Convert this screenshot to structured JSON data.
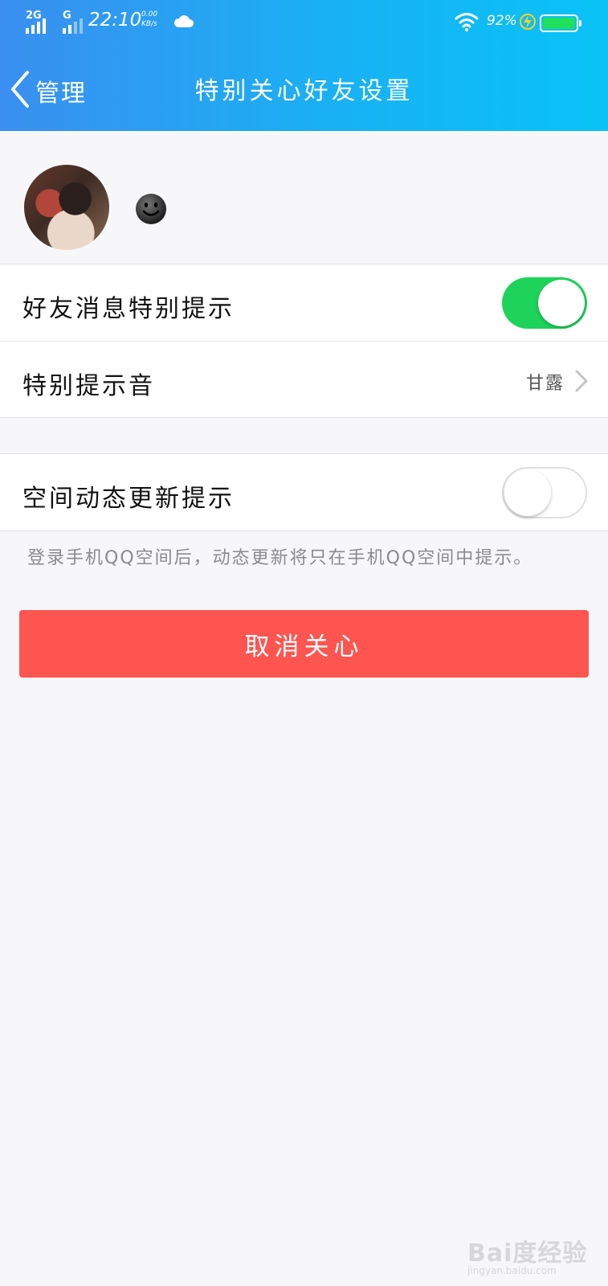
{
  "status_bar": {
    "network_1": "2G",
    "network_2": "G",
    "time": "22:10",
    "speed_value": "0.00",
    "speed_unit": "KB/s",
    "battery_percent": "92%",
    "icons": [
      "signal-icon",
      "cloud-icon",
      "wifi-icon",
      "charging-icon",
      "battery-icon"
    ]
  },
  "nav": {
    "back_label": "管理",
    "title": "特别关心好友设置"
  },
  "settings": {
    "group1": [
      {
        "label": "好友消息特别提示",
        "type": "switch",
        "on": true
      },
      {
        "label": "特别提示音",
        "type": "link",
        "value": "甘露"
      }
    ],
    "group2": [
      {
        "label": "空间动态更新提示",
        "type": "switch",
        "on": false
      }
    ],
    "note": "登录手机QQ空间后，动态更新将只在手机QQ空间中提示。"
  },
  "cancel_button": "取消关心",
  "watermark": {
    "main": "Bai度经验",
    "sub": "jingyan.baidu.com"
  },
  "colors": {
    "header_start": "#3a8ff0",
    "header_end": "#09c2f6",
    "switch_on": "#1dd35a",
    "cancel": "#fe5550",
    "page_bg": "#f7f7f9"
  }
}
